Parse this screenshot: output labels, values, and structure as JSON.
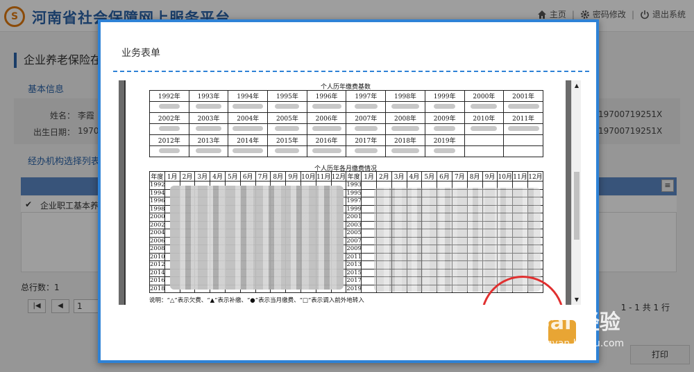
{
  "header": {
    "logo_text": "S",
    "site_title": "河南省社会保障网上服务平台",
    "nav": {
      "home": "主页",
      "password": "密码修改",
      "logout": "退出系统"
    }
  },
  "page": {
    "heading": "企业养老保险在",
    "basic_info_title": "基本信息",
    "name_label": "姓名：",
    "name_value": "李霞",
    "birth_label": "出生日期：",
    "birth_value": "1970",
    "id_value_1": "19700719251X",
    "id_value_2": "19700719251X",
    "agency_list_title": "经办机构选择列表",
    "grid_row_text": "企业职工基本养",
    "grid_row_check": "✔",
    "grid_menu": "≡",
    "total_label": "总行数：1",
    "pager": {
      "first": "|◀",
      "prev": "◀",
      "page_input": "1",
      "info": "1 - 1 共 1 行"
    },
    "print_button": "打印"
  },
  "modal": {
    "title": "业务表单",
    "doc": {
      "base_caption": "个人历年缴费基数",
      "base_years_row1": [
        "1992年",
        "1993年",
        "1994年",
        "1995年",
        "1996年",
        "1997年",
        "1998年",
        "1999年",
        "2000年",
        "2001年"
      ],
      "base_years_row2": [
        "2002年",
        "2003年",
        "2004年",
        "2005年",
        "2006年",
        "2007年",
        "2008年",
        "2009年",
        "2010年",
        "2011年"
      ],
      "base_years_row3": [
        "2012年",
        "2013年",
        "2014年",
        "2015年",
        "2016年",
        "2017年",
        "2018年",
        "2019年"
      ],
      "monthly_caption": "个人历年各月缴费情况",
      "monthly_header": [
        "年度",
        "1月",
        "2月",
        "3月",
        "4月",
        "5月",
        "6月",
        "7月",
        "8月",
        "9月",
        "10月",
        "11月",
        "12月"
      ],
      "monthly_years_left": [
        "1992",
        "1994",
        "1996",
        "1998",
        "2000",
        "2002",
        "2004",
        "2006",
        "2008",
        "2010",
        "2012",
        "2014",
        "2016",
        "2018"
      ],
      "monthly_years_right": [
        "1993",
        "1995",
        "1997",
        "1999",
        "2001",
        "2003",
        "2005",
        "2007",
        "2009",
        "2011",
        "2013",
        "2015",
        "2017",
        "2019"
      ],
      "note": "说明：“△”表示欠费、“▲”表示补缴、“●”表示当月缴费、“□”表示调入前外地转入"
    }
  },
  "watermark": {
    "brand": "Bai 经验",
    "url": "jingyan.baidu.com"
  },
  "colors": {
    "brand_blue": "#2a63a8",
    "modal_border": "#2e82d6",
    "grid_header": "#5b88c6",
    "stamp_red": "#e03030"
  }
}
